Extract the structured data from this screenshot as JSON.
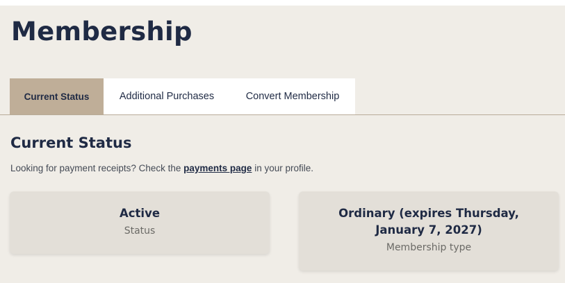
{
  "page": {
    "title": "Membership"
  },
  "tabs": [
    {
      "label": "Current Status",
      "active": true
    },
    {
      "label": "Additional Purchases",
      "active": false
    },
    {
      "label": "Convert Membership",
      "active": false
    }
  ],
  "section": {
    "title": "Current Status",
    "info_prefix": "Looking for payment receipts? Check the ",
    "info_link": "payments page",
    "info_suffix": " in your profile."
  },
  "cards": [
    {
      "value": "Active",
      "label": "Status"
    },
    {
      "value": "Ordinary (expires Thursday, January 7, 2027)",
      "label": "Membership type"
    }
  ],
  "colors": {
    "page_bg": "#f0ede7",
    "active_tab_bg": "#bfae98",
    "card_bg": "#e3dfd8",
    "title_text": "#1f2a44"
  }
}
